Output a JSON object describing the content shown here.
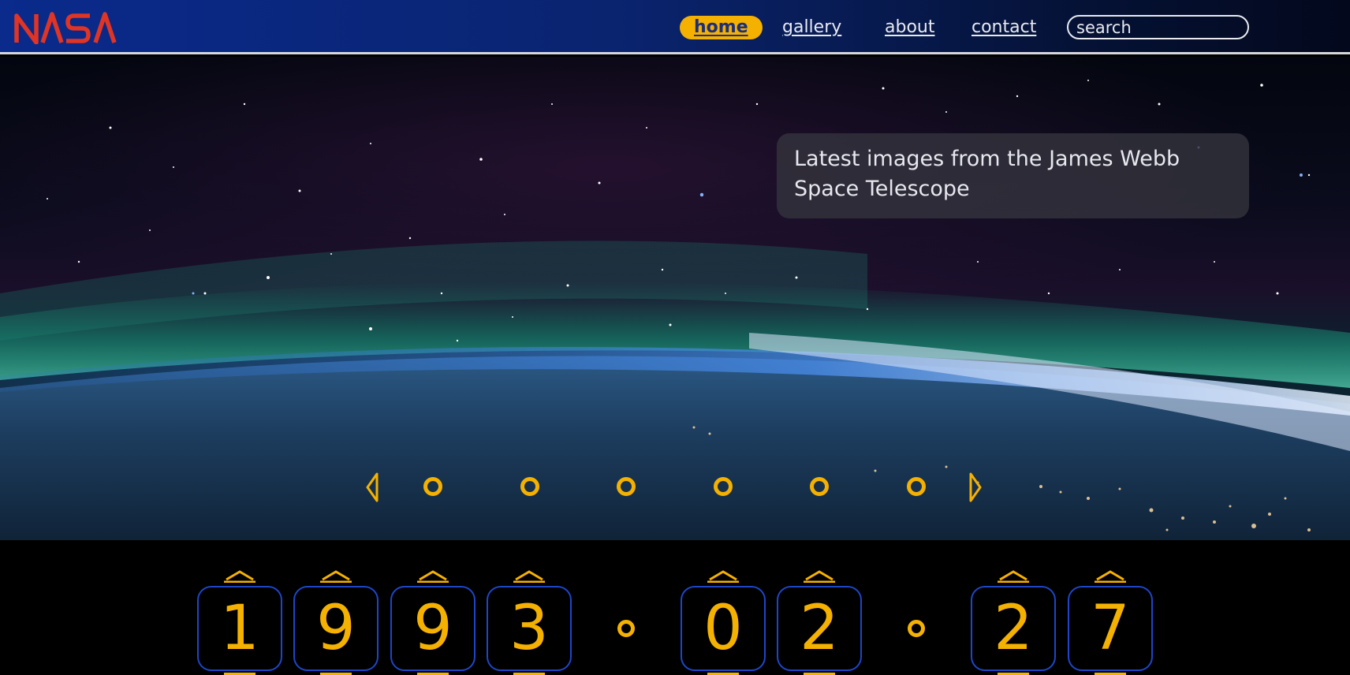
{
  "brand": {
    "logo_text": "NASA",
    "logo_color": "#e03424"
  },
  "nav": {
    "links": [
      {
        "label": "home",
        "active": true
      },
      {
        "label": "gallery",
        "active": false
      },
      {
        "label": "about",
        "active": false
      },
      {
        "label": "contact",
        "active": false
      }
    ],
    "search_placeholder": "search"
  },
  "hero": {
    "caption": "Latest images from the James Webb Space Telescope",
    "carousel": {
      "prev_icon": "triangle-left-icon",
      "next_icon": "triangle-right-icon",
      "slide_count": 6
    }
  },
  "date_counter": {
    "digits": [
      "1",
      "9",
      "9",
      "3",
      "0",
      "2",
      "2",
      "7"
    ],
    "separator_icon": "circle-dot-icon"
  },
  "colors": {
    "accent": "#f5b100",
    "header_blue": "#0a2a8c",
    "digit_border": "#1d46c9",
    "text_light": "#e8eaf0"
  }
}
